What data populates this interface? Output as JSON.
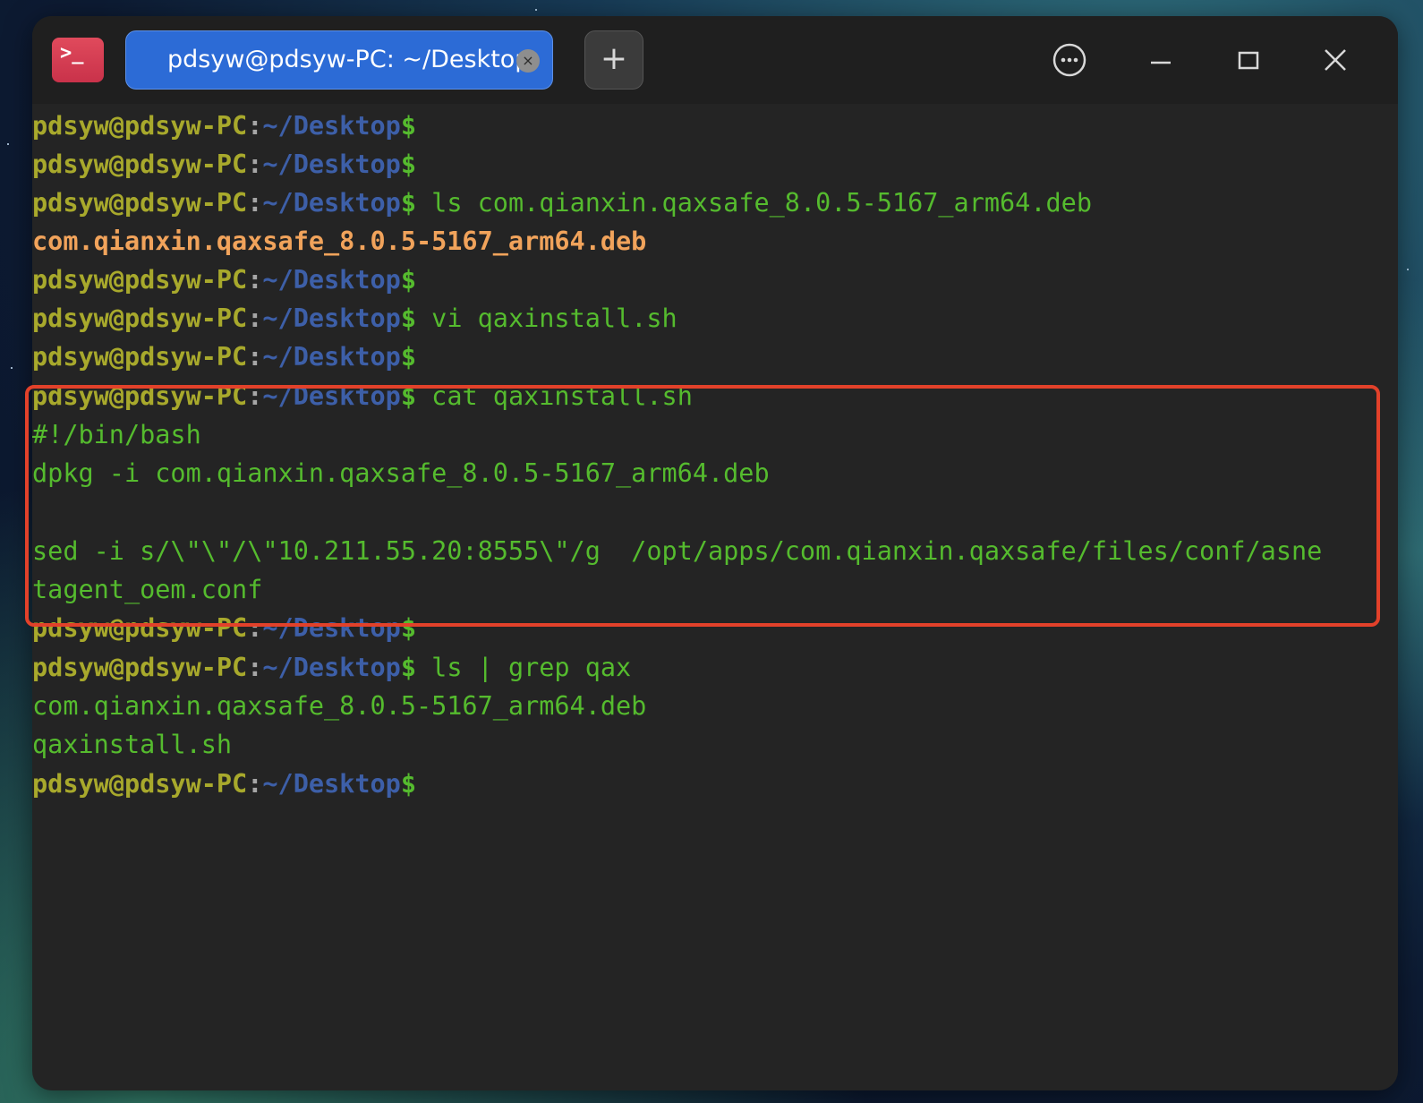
{
  "window": {
    "tab_title": "pdsyw@pdsyw-PC: ~/Desktop",
    "app_icon_glyph": ">_",
    "new_tab_glyph": "+",
    "tab_close_glyph": "×"
  },
  "prompt": {
    "user": "pdsyw@pdsyw-PC",
    "colon": ":",
    "path": "~/Desktop",
    "dollar": "$"
  },
  "terminal": {
    "cmd1": " ls com.qianxin.qaxsafe_8.0.5-5167_arm64.deb",
    "out1": "com.qianxin.qaxsafe_8.0.5-5167_arm64.deb",
    "cmd2": " vi qaxinstall.sh",
    "cmd3": " cat qaxinstall.sh",
    "script_line1": "#!/bin/bash",
    "script_line2": "dpkg -i com.qianxin.qaxsafe_8.0.5-5167_arm64.deb",
    "script_line3": "sed -i s/\\\"\\\"/\\\"10.211.55.20:8555\\\"/g  /opt/apps/com.qianxin.qaxsafe/files/conf/asne",
    "script_line3_wrap": "tagent_oem.conf",
    "cmd4": " ls | grep qax",
    "out4a": "com.qianxin.qaxsafe_8.0.5-5167_arm64.deb",
    "out4b": "qaxinstall.sh"
  },
  "colors": {
    "prompt_user": "#a8a92c",
    "prompt_path": "#3d5fa8",
    "command_text": "#55bb2e",
    "deb_file": "#f1a35b",
    "highlight_border": "#e2412a",
    "tab_active": "#2c6bd6"
  }
}
